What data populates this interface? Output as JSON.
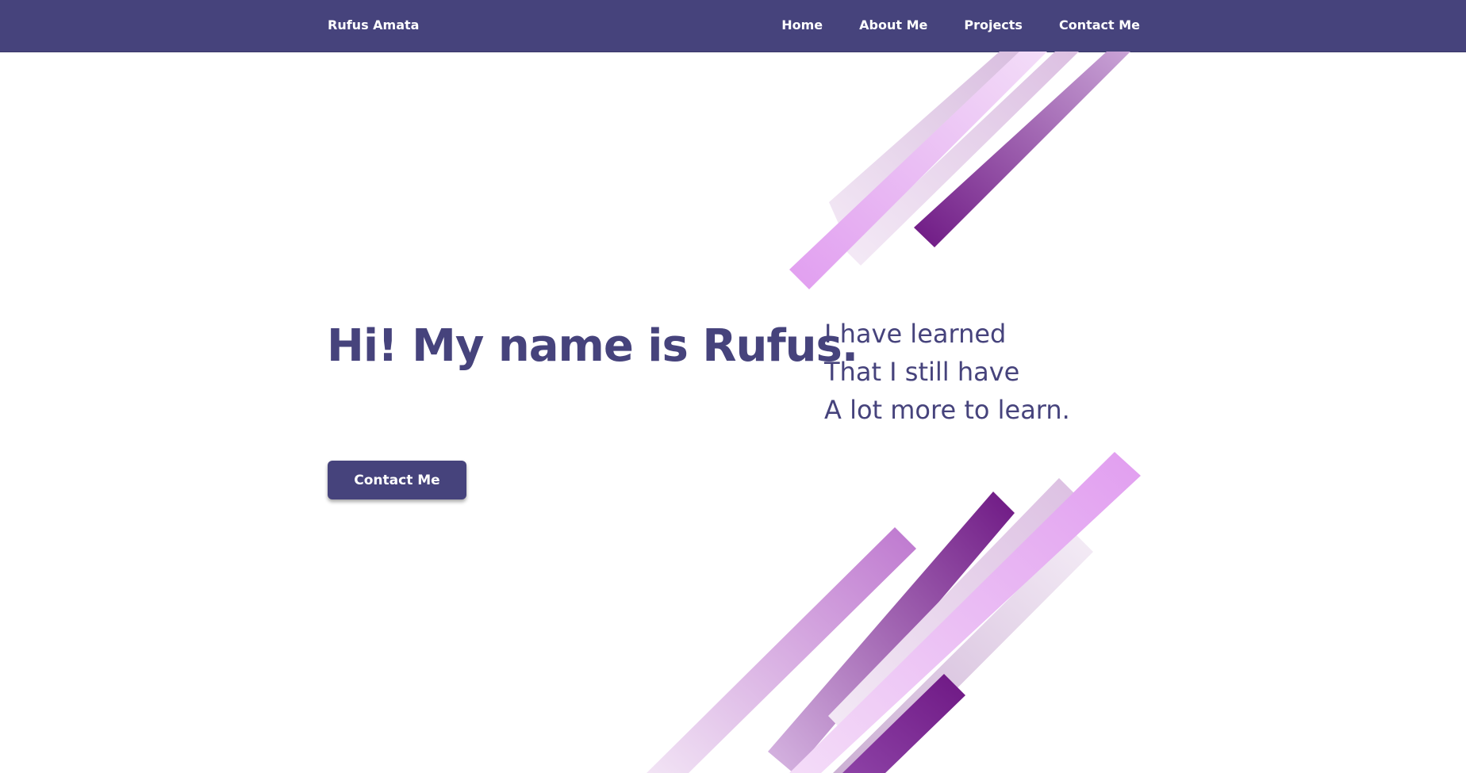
{
  "navbar": {
    "brand": "Rufus Amata",
    "links": [
      {
        "label": "Home"
      },
      {
        "label": "About Me"
      },
      {
        "label": "Projects"
      },
      {
        "label": "Contact Me"
      }
    ]
  },
  "hero": {
    "title": "Hi! My name is Rufus.",
    "poem": [
      "I have learned",
      "That I still have",
      "A lot more to learn."
    ],
    "cta_label": "Contact Me"
  },
  "colors": {
    "primary": "#46437c",
    "accent_light": "#e19ef0",
    "accent_dark": "#6e1884",
    "background": "#ffffff"
  }
}
